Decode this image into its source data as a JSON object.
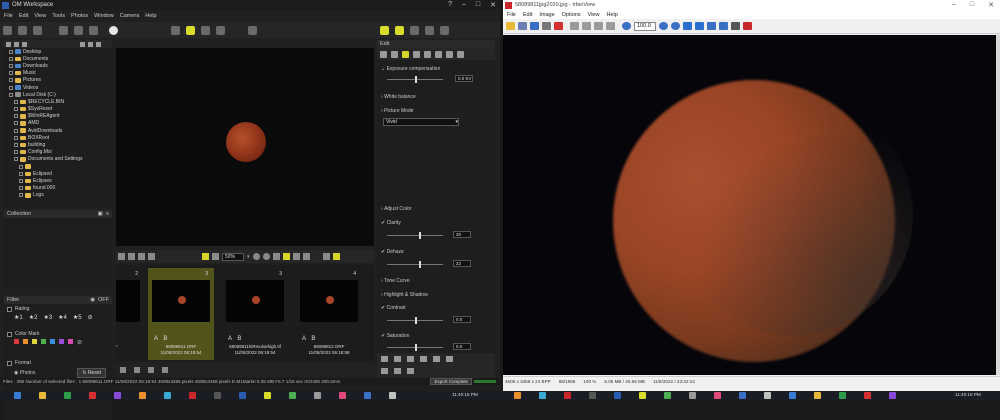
{
  "omw": {
    "title": "OM Workspace",
    "menu": [
      "File",
      "Edit",
      "View",
      "Tools",
      "Photos",
      "Window",
      "Camera",
      "Help"
    ],
    "window_controls": [
      "help-icon",
      "minimize-icon",
      "maximize-icon",
      "close-icon"
    ],
    "tree": [
      {
        "label": "Desktop",
        "indent": 1,
        "kind": "blue"
      },
      {
        "label": "Documents",
        "indent": 1,
        "kind": "folder"
      },
      {
        "label": "Downloads",
        "indent": 1,
        "kind": "blue"
      },
      {
        "label": "Music",
        "indent": 1,
        "kind": "folder"
      },
      {
        "label": "Pictures",
        "indent": 1,
        "kind": "folder"
      },
      {
        "label": "Videos",
        "indent": 1,
        "kind": "blue"
      },
      {
        "label": "Local Disk (C:)",
        "indent": 1,
        "kind": "drive"
      },
      {
        "label": "$RECYCLE.BIN",
        "indent": 2,
        "kind": "folder"
      },
      {
        "label": "$SysReset",
        "indent": 2,
        "kind": "folder"
      },
      {
        "label": "$WinREAgent",
        "indent": 2,
        "kind": "folder"
      },
      {
        "label": "AMD",
        "indent": 2,
        "kind": "folder"
      },
      {
        "label": "AvidDownloads",
        "indent": 2,
        "kind": "folder"
      },
      {
        "label": "BOXRoot",
        "indent": 2,
        "kind": "folder"
      },
      {
        "label": "building",
        "indent": 2,
        "kind": "folder"
      },
      {
        "label": "Config.Msi",
        "indent": 2,
        "kind": "folder"
      },
      {
        "label": "Documents and Settings",
        "indent": 2,
        "kind": "folder"
      },
      {
        "label": "",
        "indent": 3,
        "kind": "folder",
        "selected": true
      },
      {
        "label": "Eclipsed",
        "indent": 3,
        "kind": "folder"
      },
      {
        "label": "Eclipses",
        "indent": 3,
        "kind": "folder"
      },
      {
        "label": "found.000",
        "indent": 3,
        "kind": "folder"
      },
      {
        "label": "Logs",
        "indent": 3,
        "kind": "folder"
      }
    ],
    "collection_label": "Collection",
    "filter": {
      "title": "Filter",
      "off_label": "OFF",
      "rating_label": "Rating",
      "stars": [
        "★1",
        "★2",
        "★3",
        "★4",
        "★5"
      ],
      "color_mark_label": "Color Mark",
      "swatches": [
        "#d83a3a",
        "#e8902a",
        "#e2d440",
        "#4caf50",
        "#3a8ee0",
        "#9c4ad8",
        "#d94bb0"
      ],
      "format_label": "Format",
      "photos_label": "Photos",
      "reset_label": "Reset"
    },
    "zoom_value": "50%",
    "thumbs": [
      {
        "num": "2",
        "ab": "",
        "name": "...ORF",
        "date": "...:55",
        "selected": false
      },
      {
        "num": "3",
        "ab": "A B",
        "name": "58089811.ORF",
        "date": "11/08/2022 06:18:54",
        "selected": true
      },
      {
        "num": "3",
        "ab": "A B",
        "name": "58089811hiRmoisehigh.tif",
        "date": "11/08/2022 06:18:54",
        "selected": false
      },
      {
        "num": "4",
        "ab": "A B",
        "name": "58089812.ORF",
        "date": "11/08/2022 06:18:58",
        "selected": false
      }
    ],
    "edit": {
      "title": "Edit",
      "exposure_label": "Exposure compensation",
      "exposure_value": "0.0 EV",
      "white_balance_label": "White balance",
      "picture_mode_label": "Picture Mode",
      "picture_mode_value": "Vivid",
      "adjust_color_label": "Adjust Color",
      "clarity_label": "Clarity",
      "clarity_value": "20",
      "dehaze_label": "Dehaze",
      "dehaze_value": "22",
      "tone_curve_label": "Tone Curve",
      "highlight_shadow_label": "Highlight & Shadow",
      "contrast_label": "Contrast",
      "contrast_value": "0.0",
      "saturation_label": "Saturation",
      "saturation_value": "0.0"
    },
    "status": "Files : 385  Number of selected files : 1  58089811.ORF  11/08/2022 06:18:54  4608x3456 pixels  4608x3456 pixels  E-M1MarkII  5.05 MB  F6.7  1/15 sec  ISO400  300.0mm",
    "export_label": "Export Complete"
  },
  "irf": {
    "title": "58089811jpg2020.jpg - IrfanView",
    "menu": [
      "File",
      "Edit",
      "Image",
      "Options",
      "View",
      "Help"
    ],
    "zoom_value": "100.0",
    "status": [
      "4608 x 3456 x 24 BPP",
      "88/1986",
      "100 %",
      "5.05 MB / 45.56 MB",
      "11/8/2022 / 23:32:24"
    ]
  },
  "taskbar": {
    "left_clock": "11:40:16 PM",
    "right_clock": "11:40:16 PM"
  }
}
